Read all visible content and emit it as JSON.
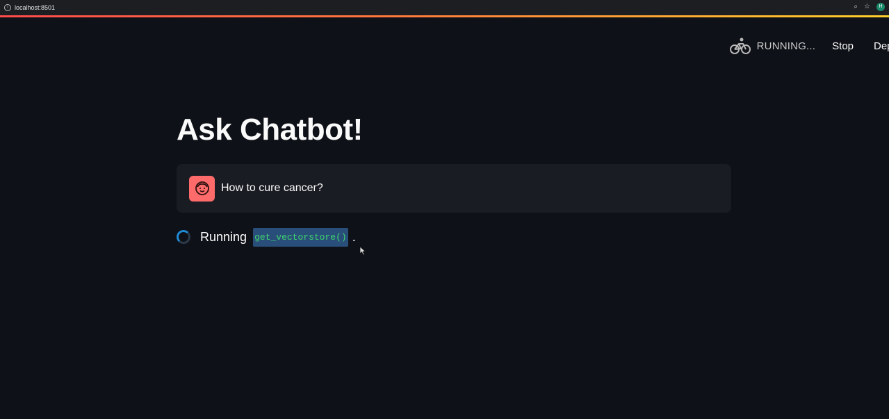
{
  "browser": {
    "url": "localhost:8501",
    "profile_initial": "H"
  },
  "toolbar": {
    "status_icon": "bicycle-icon",
    "status_label": "RUNNING...",
    "stop_label": "Stop",
    "deploy_label": "Dep"
  },
  "colors": {
    "background": "#0e1117",
    "chat_bg": "#1a1c23",
    "avatar_bg": "#ff6b6b",
    "spinner": "#1f8bd6",
    "code_text": "#3dd56d",
    "code_highlight": "#2a4e7a"
  },
  "main": {
    "title": "Ask Chatbot!",
    "messages": [
      {
        "role": "user",
        "avatar_icon": "user-face-icon",
        "text": "How to cure cancer?"
      }
    ],
    "status": {
      "prefix": "Running",
      "code": "get_vectorstore()",
      "suffix": "."
    }
  }
}
